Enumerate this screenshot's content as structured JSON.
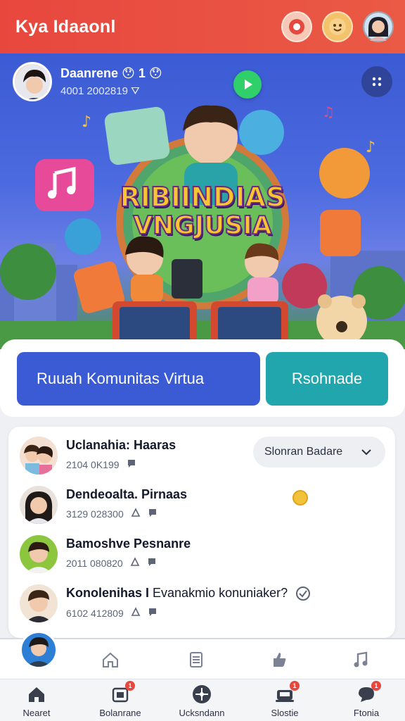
{
  "header": {
    "title": "Kya Idaaonl",
    "icons": [
      "record-icon",
      "emoji-icon",
      "user-avatar"
    ],
    "accent": "#e8473e"
  },
  "hero": {
    "profile_name": "Daanrene",
    "profile_emojis": "😯 1 😯",
    "profile_meta": "4001 2002819",
    "title_line1": "RIBIINDIAS",
    "title_line2": "VNGJUSIA"
  },
  "actions": {
    "primary_label": "Ruuah Komunitas Virtua",
    "secondary_label": "Rsohnade",
    "primary_color": "#3b5bd4",
    "secondary_color": "#22a6ad"
  },
  "list": {
    "sort_label": "Slonran Badare",
    "rows": [
      {
        "title": "Uclanahia: Haaras",
        "meta": "2104 0K199"
      },
      {
        "title": "Dendeoalta. Pirnaas",
        "meta": "3129 028300"
      },
      {
        "title": "Bamoshve Pesnanre",
        "meta": "2011 080820"
      },
      {
        "title": "Konolenihas I",
        "title_extra": "Evanakmio konuniaker?",
        "meta": "6102 412809"
      }
    ]
  },
  "bottom_nav": {
    "items": [
      {
        "label": "Nearet",
        "icon": "home-icon",
        "badge": ""
      },
      {
        "label": "Bolanrane",
        "icon": "inbox-icon",
        "badge": "1"
      },
      {
        "label": "Ucksndann",
        "icon": "compass-icon",
        "badge": ""
      },
      {
        "label": "Slostie",
        "icon": "device-icon",
        "badge": "1"
      },
      {
        "label": "Ftonia",
        "icon": "chat-icon",
        "badge": "1"
      }
    ]
  }
}
